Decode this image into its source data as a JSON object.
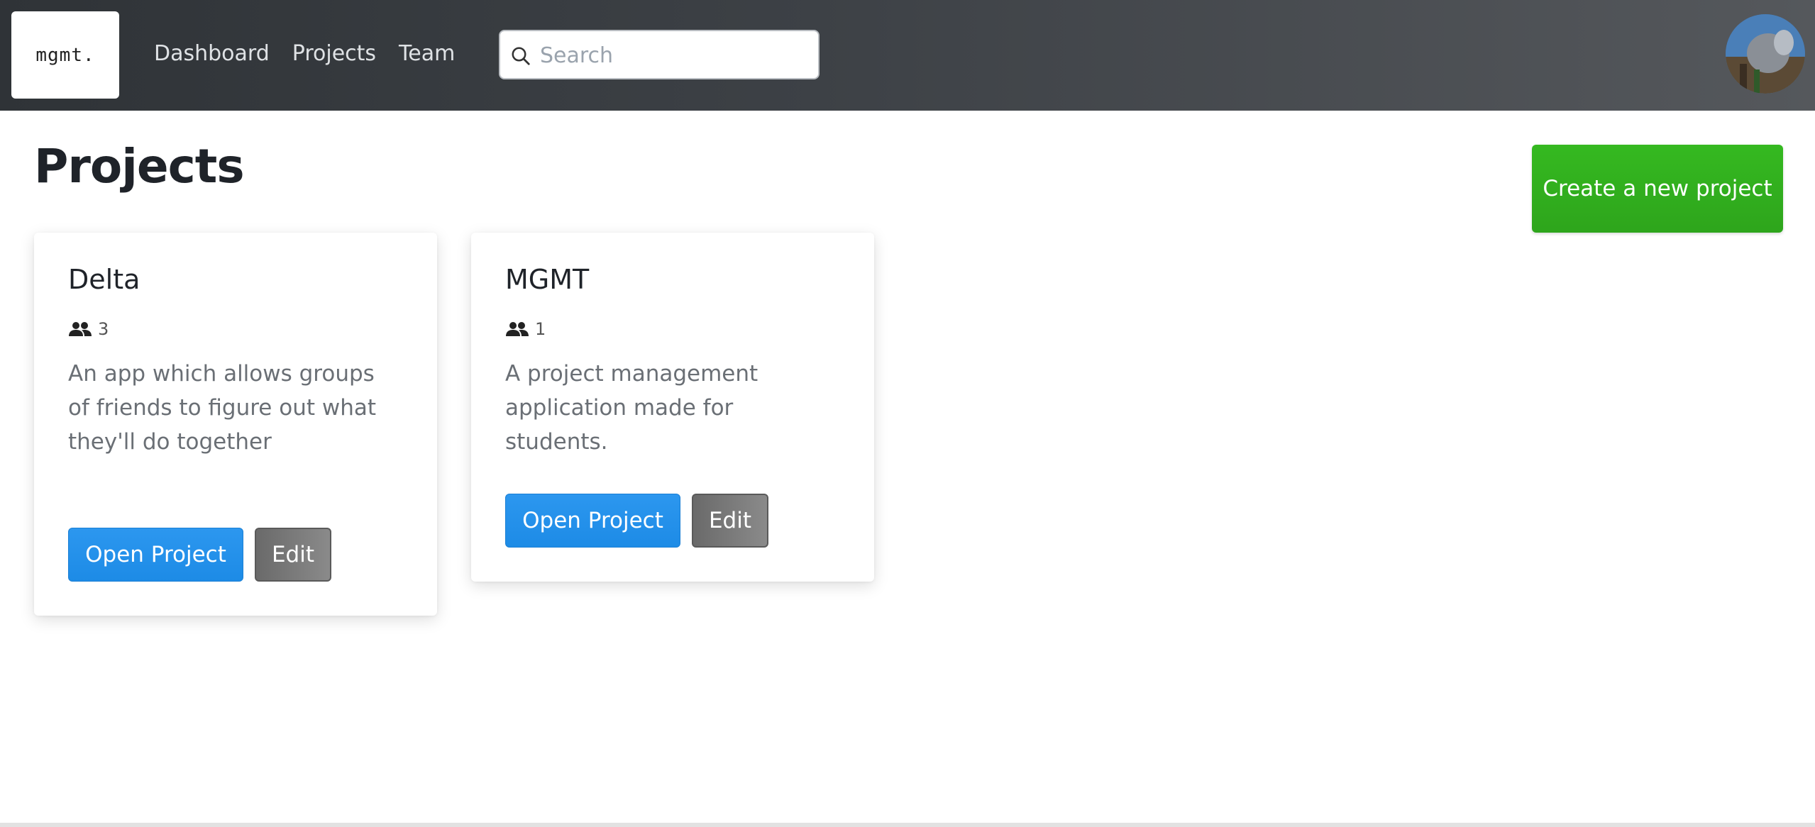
{
  "navbar": {
    "logo_text": "mgmt.",
    "links": [
      "Dashboard",
      "Projects",
      "Team"
    ],
    "search_placeholder": "Search",
    "search_value": ""
  },
  "page": {
    "title": "Projects",
    "create_button": "Create a new project"
  },
  "projects": [
    {
      "name": "Delta",
      "members": "3",
      "description": "An app which allows groups of friends to figure out what they'll do together",
      "open_label": "Open Project",
      "edit_label": "Edit"
    },
    {
      "name": "MGMT",
      "members": "1",
      "description": "A project management application made for students.",
      "open_label": "Open Project",
      "edit_label": "Edit"
    }
  ],
  "icons": {
    "search": "search-icon",
    "members": "people-icon",
    "avatar": "user-avatar"
  },
  "colors": {
    "primary": "#1d8be6",
    "success": "#2ea51c",
    "secondary": "#6a6a6a"
  }
}
